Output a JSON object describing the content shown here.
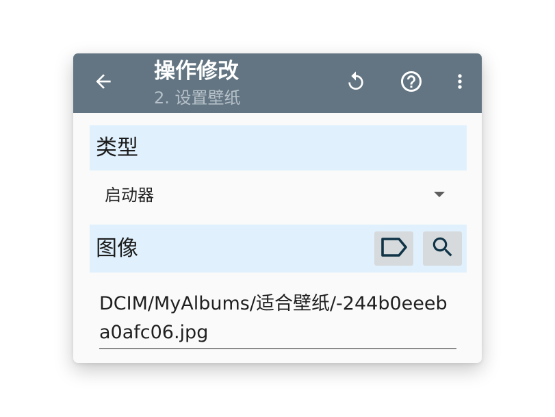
{
  "toolbar": {
    "title": "操作修改",
    "subtitle": "2. 设置壁纸"
  },
  "icons": {
    "back": "arrow-back-icon",
    "reset": "undo-icon",
    "help": "help-circle-icon",
    "more": "more-vertical-icon",
    "tag": "label-tag-icon",
    "search": "search-icon"
  },
  "type_section": {
    "label": "类型",
    "selected_value": "启动器"
  },
  "image_section": {
    "label": "图像",
    "path_value": "DCIM/MyAlbums/适合壁纸/-244b0eeeba0afc06.jpg"
  },
  "colors": {
    "toolbar_bg": "#637582",
    "section_header_bg": "#e0f1fd",
    "button_bg": "#d6dadd",
    "icon_dark": "#0f3347"
  }
}
